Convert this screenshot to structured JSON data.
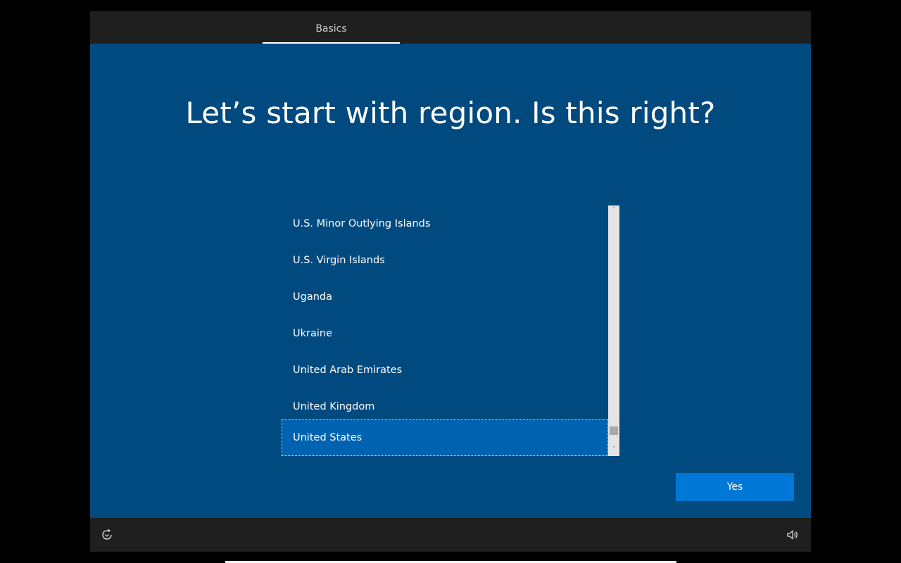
{
  "topbar": {
    "tab_label": "Basics"
  },
  "main": {
    "heading": "Let’s start with region. Is this right?"
  },
  "region_list": {
    "items": [
      "U.S. Minor Outlying Islands",
      "U.S. Virgin Islands",
      "Uganda",
      "Ukraine",
      "United Arab Emirates",
      "United Kingdom",
      "United States"
    ],
    "selected": "United States",
    "scroll_up_glyph": "˄",
    "scroll_down_glyph": "˅"
  },
  "actions": {
    "yes_label": "Yes"
  },
  "bottombar": {
    "left_icon": "ease-of-access-icon",
    "right_icon": "volume-icon"
  },
  "colors": {
    "background": "#004a7f",
    "bar": "#1f1f1f",
    "selected_item": "#0063b1",
    "accent_button": "#0078d7"
  }
}
